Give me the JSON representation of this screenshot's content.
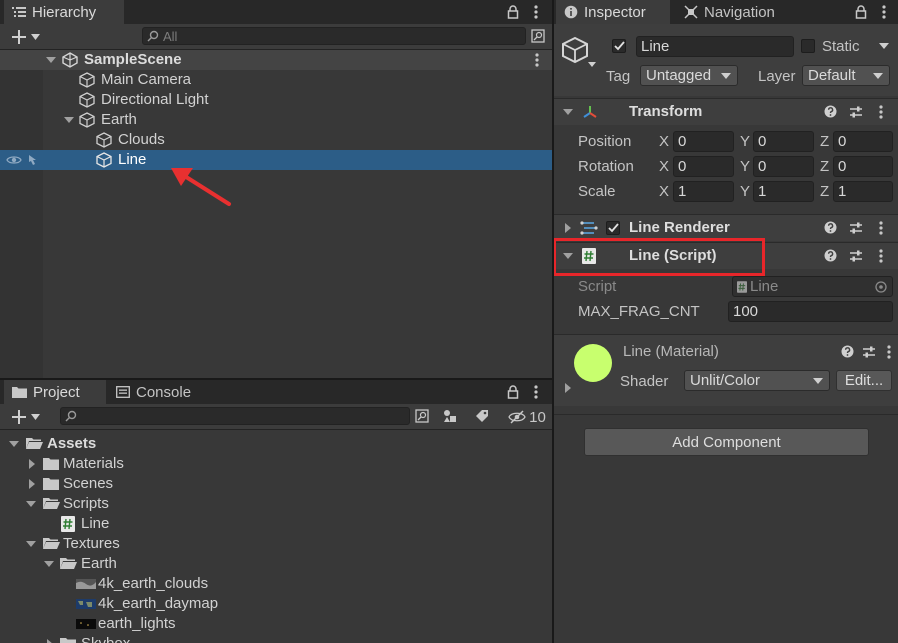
{
  "hierarchy": {
    "tab_label": "Hierarchy",
    "search_placeholder": "All",
    "scene_name": "SampleScene",
    "items": [
      {
        "label": "Main Camera",
        "depth": 1
      },
      {
        "label": "Directional Light",
        "depth": 1
      },
      {
        "label": "Earth",
        "depth": 1
      },
      {
        "label": "Clouds",
        "depth": 2
      },
      {
        "label": "Line",
        "depth": 2,
        "selected": true
      }
    ]
  },
  "project": {
    "tab_label": "Project",
    "console_tab_label": "Console",
    "hidden_count": "10",
    "tree": [
      {
        "label": "Assets",
        "depth": 0,
        "expanded": true,
        "type": "folder"
      },
      {
        "label": "Materials",
        "depth": 1,
        "expanded": false,
        "type": "folder"
      },
      {
        "label": "Scenes",
        "depth": 1,
        "expanded": false,
        "type": "folder"
      },
      {
        "label": "Scripts",
        "depth": 1,
        "expanded": true,
        "type": "folder"
      },
      {
        "label": "Line",
        "depth": 2,
        "type": "script"
      },
      {
        "label": "Textures",
        "depth": 1,
        "expanded": true,
        "type": "folder"
      },
      {
        "label": "Earth",
        "depth": 2,
        "expanded": true,
        "type": "folder"
      },
      {
        "label": "4k_earth_clouds",
        "depth": 3,
        "type": "texture"
      },
      {
        "label": "4k_earth_daymap",
        "depth": 3,
        "type": "texture"
      },
      {
        "label": "earth_lights",
        "depth": 3,
        "type": "texture"
      },
      {
        "label": "Skybox",
        "depth": 2,
        "expanded": false,
        "type": "folder"
      }
    ]
  },
  "inspector": {
    "tab_label": "Inspector",
    "navigation_tab_label": "Navigation",
    "object_name": "Line",
    "static_label": "Static",
    "tag_label": "Tag",
    "tag_value": "Untagged",
    "layer_label": "Layer",
    "layer_value": "Default",
    "transform": {
      "title": "Transform",
      "rows": [
        {
          "label": "Position",
          "x": "0",
          "y": "0",
          "z": "0"
        },
        {
          "label": "Rotation",
          "x": "0",
          "y": "0",
          "z": "0"
        },
        {
          "label": "Scale",
          "x": "1",
          "y": "1",
          "z": "1"
        }
      ]
    },
    "line_renderer": {
      "title": "Line Renderer"
    },
    "line_script": {
      "title": "Line (Script)",
      "script_label": "Script",
      "script_value": "Line",
      "field_label": "MAX_FRAG_CNT",
      "field_value": "100"
    },
    "material": {
      "title": "Line (Material)",
      "shader_label": "Shader",
      "shader_value": "Unlit/Color",
      "edit_label": "Edit...",
      "swatch_color": "#c8ff6e"
    },
    "add_component_label": "Add Component"
  },
  "axis_labels": {
    "x": "X",
    "y": "Y",
    "z": "Z"
  },
  "colors": {
    "selection": "#2c5d87",
    "highlight_box": "#e8262a",
    "arrow": "#e83030"
  }
}
